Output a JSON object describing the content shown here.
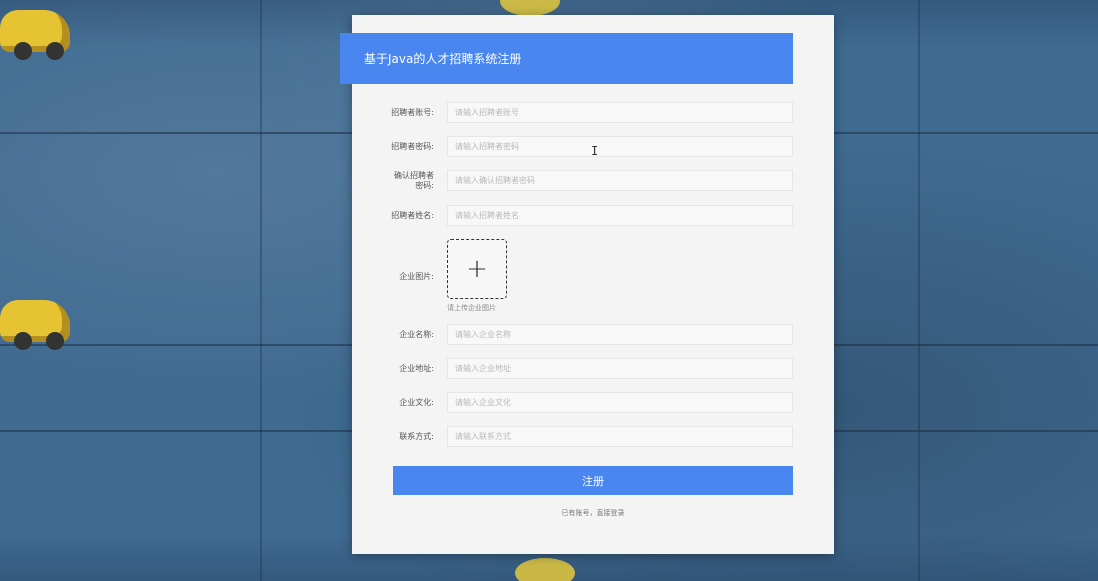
{
  "form": {
    "title": "基于Java的人才招聘系统注册",
    "fields": [
      {
        "label": "招聘者账号:",
        "placeholder": "请输入招聘者账号"
      },
      {
        "label": "招聘者密码:",
        "placeholder": "请输入招聘者密码"
      },
      {
        "label": "确认招聘者密码:",
        "placeholder": "请输入确认招聘者密码"
      },
      {
        "label": "招聘者姓名:",
        "placeholder": "请输入招聘者姓名"
      }
    ],
    "image_upload": {
      "label": "企业图片:",
      "plus_icon": "+",
      "tip": "请上传企业图片"
    },
    "fields2": [
      {
        "label": "企业名称:",
        "placeholder": "请输入企业名称"
      },
      {
        "label": "企业地址:",
        "placeholder": "请输入企业地址"
      },
      {
        "label": "企业文化:",
        "placeholder": "请输入企业文化"
      },
      {
        "label": "联系方式:",
        "placeholder": "请输入联系方式"
      }
    ],
    "submit_label": "注册",
    "login_link": "已有账号，直接登录"
  },
  "colors": {
    "accent": "#4a86f0",
    "card_bg": "#f4f4f4",
    "page_bg": "#3f6a91"
  },
  "icons": {
    "upload": "plus-icon",
    "cursor": "text-cursor-icon"
  }
}
